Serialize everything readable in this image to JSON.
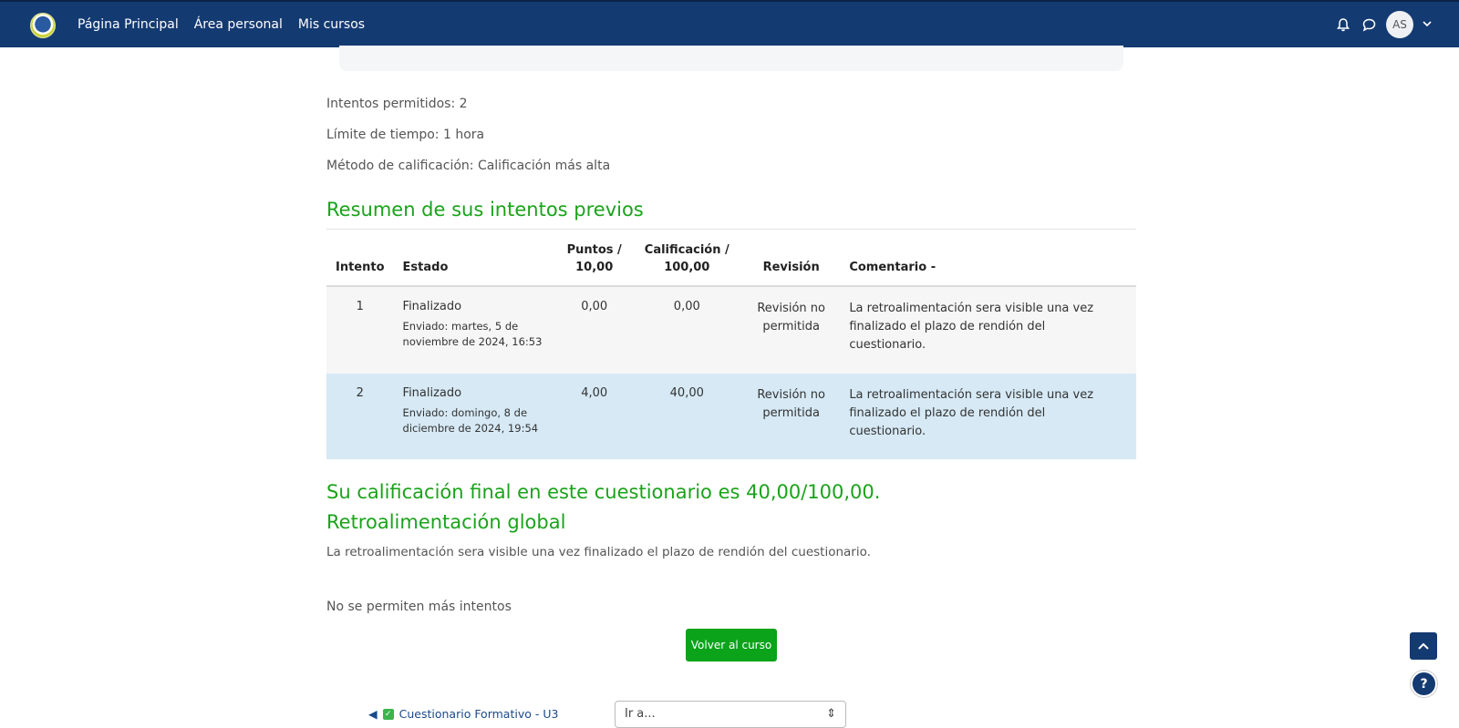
{
  "nav": {
    "links": [
      "Página Principal",
      "Área personal",
      "Mis cursos"
    ],
    "avatar_initials": "AS",
    "icons": [
      "bell-icon",
      "chat-icon",
      "chevron-down-icon"
    ],
    "bg_color": "#143a72"
  },
  "quiz_info": {
    "attempts_allowed": "Intentos permitidos: 2",
    "time_limit": "Límite de tiempo: 1 hora",
    "grading_method": "Método de calificación: Calificación más alta"
  },
  "summary": {
    "heading": "Resumen de sus intentos previos",
    "columns": {
      "attempt": "Intento",
      "state": "Estado",
      "points_line1": "Puntos /",
      "points_line2": "10,00",
      "grade_line1": "Calificación /",
      "grade_line2": "100,00",
      "review": "Revisión",
      "comment": "Comentario -"
    },
    "rows": [
      {
        "attempt": "1",
        "state": "Finalizado",
        "submitted_line1": "Enviado: martes, 5 de",
        "submitted_line2": "noviembre de 2024, 16:53",
        "points": "0,00",
        "grade": "0,00",
        "review_line1": "Revisión no",
        "review_line2": "permitida",
        "comment_line1": "La retroalimentación sera visible una vez",
        "comment_line2": "finalizado el plazo de rendión del",
        "comment_line3": "cuestionario."
      },
      {
        "attempt": "2",
        "state": "Finalizado",
        "submitted_line1": "Enviado: domingo, 8 de",
        "submitted_line2": "diciembre de 2024, 19:54",
        "points": "4,00",
        "grade": "40,00",
        "review_line1": "Revisión no",
        "review_line2": "permitida",
        "comment_line1": "La retroalimentación sera visible una vez",
        "comment_line2": "finalizado el plazo de rendión del",
        "comment_line3": "cuestionario."
      }
    ]
  },
  "final_grade": "Su calificación final en este cuestionario es 40,00/100,00.",
  "global_feedback": {
    "heading": "Retroalimentación global",
    "text": "La retroalimentación sera visible una vez finalizado el plazo de rendión del cuestionario."
  },
  "no_more_attempts": "No se permiten más intentos",
  "back_button": "Volver al curso",
  "footer_nav": {
    "prev_activity": "Cuestionario Formativo - U3",
    "jump_select": "Ir a..."
  },
  "accent_green": "#1aa31a"
}
